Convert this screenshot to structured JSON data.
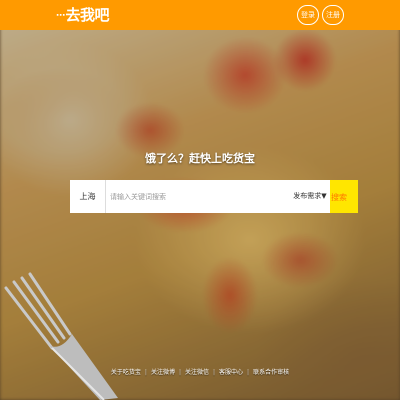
{
  "header": {
    "logo": "去我吧",
    "login_label": "登录",
    "register_label": "注册"
  },
  "hero": {
    "headline": "饿了么？赶快上吃货宝"
  },
  "search": {
    "city": "上海",
    "placeholder": "请输入关键词搜索",
    "button_label": "搜索",
    "publish_label": "发布需求▼"
  },
  "footer": {
    "links": [
      "关于吃货宝",
      "关注微博",
      "关注微信",
      "客服中心",
      "联系合作审核"
    ]
  },
  "colors": {
    "top_bar": "#ff9a00",
    "search_button": "#ffe600"
  }
}
